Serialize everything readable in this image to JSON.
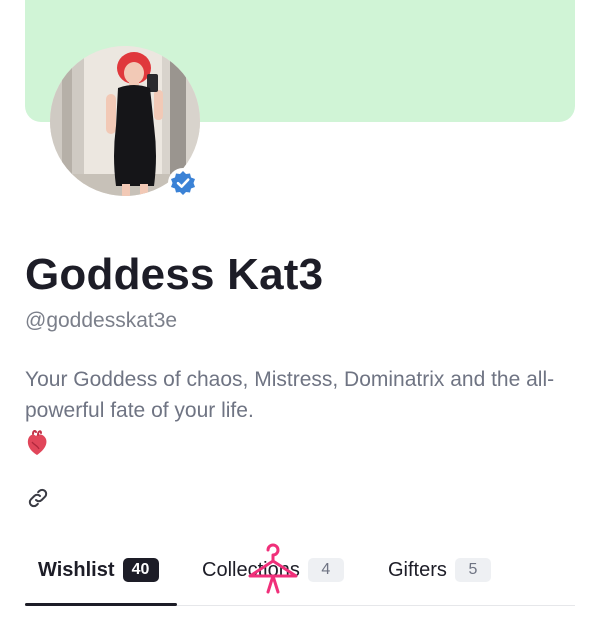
{
  "profile": {
    "display_name": "Goddess Kat3",
    "handle": "@goddesskat3e",
    "bio": "Your Goddess of chaos, Mistress, Dominatrix and the all-powerful fate of your life.",
    "verified": true
  },
  "icons": {
    "verified": "verified-check-icon",
    "heart": "anatomical-heart-emoji",
    "link": "link-icon",
    "hanger": "hanger-icon"
  },
  "tabs": [
    {
      "label": "Wishlist",
      "count": "40",
      "active": true
    },
    {
      "label": "Collections",
      "count": "4",
      "active": false
    },
    {
      "label": "Gifters",
      "count": "5",
      "active": false
    }
  ],
  "colors": {
    "banner": "#d0f4d6",
    "verified": "#3b82d6",
    "text_primary": "#1d1d27",
    "text_muted": "#6f7483",
    "hanger": "#f0307a"
  }
}
